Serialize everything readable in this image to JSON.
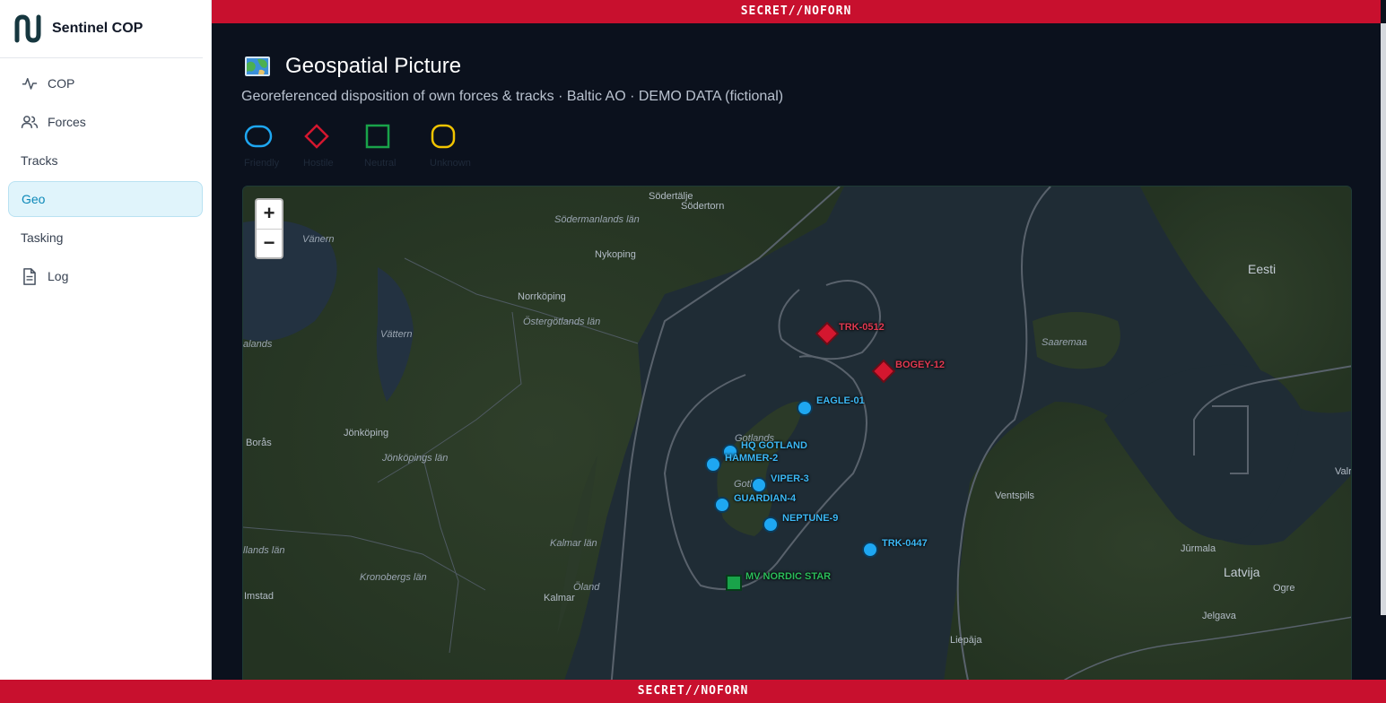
{
  "app": {
    "name": "Sentinel COP"
  },
  "classification": {
    "top": "SECRET//NOFORN",
    "bottom": "SECRET//NOFORN"
  },
  "nav": {
    "items": [
      {
        "label": "COP",
        "icon": "activity-icon"
      },
      {
        "label": "Forces",
        "icon": "users-icon"
      },
      {
        "label": "Tracks",
        "icon": ""
      },
      {
        "label": "Geo",
        "icon": "",
        "active": true
      },
      {
        "label": "Tasking",
        "icon": ""
      },
      {
        "label": "Log",
        "icon": "document-icon"
      }
    ]
  },
  "page": {
    "title": "Geospatial Picture",
    "subtitle": "Georeferenced disposition of own forces & tracks · Baltic AO · DEMO DATA (fictional)"
  },
  "legend": {
    "items": [
      {
        "label": "Friendly",
        "shape": "rounded-rect",
        "color": "#1ea7f2"
      },
      {
        "label": "Hostile",
        "shape": "diamond",
        "color": "#d4172f"
      },
      {
        "label": "Neutral",
        "shape": "square",
        "color": "#19a34a"
      },
      {
        "label": "Unknown",
        "shape": "rounded-square",
        "color": "#f2c400"
      }
    ]
  },
  "map": {
    "zoom_in": "+",
    "zoom_out": "−",
    "places": [
      "Södertälje",
      "Södertorn",
      "Södermanlands län",
      "Nykoping",
      "Vänern",
      "Norrköping",
      "Östergötlands län",
      "Vättern",
      "alands",
      "Jönköping",
      "Borås",
      "Jönköpings län",
      "Gotlands",
      "Gotl",
      "Kalmar län",
      "Kronobergs län",
      "Kalmar",
      "Öland",
      "Imstad",
      "llands län",
      "Eesti",
      "Saaremaa",
      "Ventspils",
      "Jūrmala",
      "Latvija",
      "Ogre",
      "Jelgava",
      "Liepāja",
      "Valr"
    ],
    "units": [
      {
        "label": "TRK-0512",
        "affiliation": "hostile"
      },
      {
        "label": "BOGEY-12",
        "affiliation": "hostile"
      },
      {
        "label": "EAGLE-01",
        "affiliation": "friendly"
      },
      {
        "label": "HQ GOTLAND",
        "affiliation": "friendly"
      },
      {
        "label": "HAMMER-2",
        "affiliation": "friendly"
      },
      {
        "label": "VIPER-3",
        "affiliation": "friendly"
      },
      {
        "label": "GUARDIAN-4",
        "affiliation": "friendly"
      },
      {
        "label": "NEPTUNE-9",
        "affiliation": "friendly"
      },
      {
        "label": "TRK-0447",
        "affiliation": "friendly"
      },
      {
        "label": "MV NORDIC STAR",
        "affiliation": "neutral"
      }
    ]
  },
  "colors": {
    "friendly": "#1ea7f2",
    "hostile": "#d4172f",
    "neutral": "#19a34a",
    "unknown": "#f2c400",
    "banner": "#c8102e"
  }
}
